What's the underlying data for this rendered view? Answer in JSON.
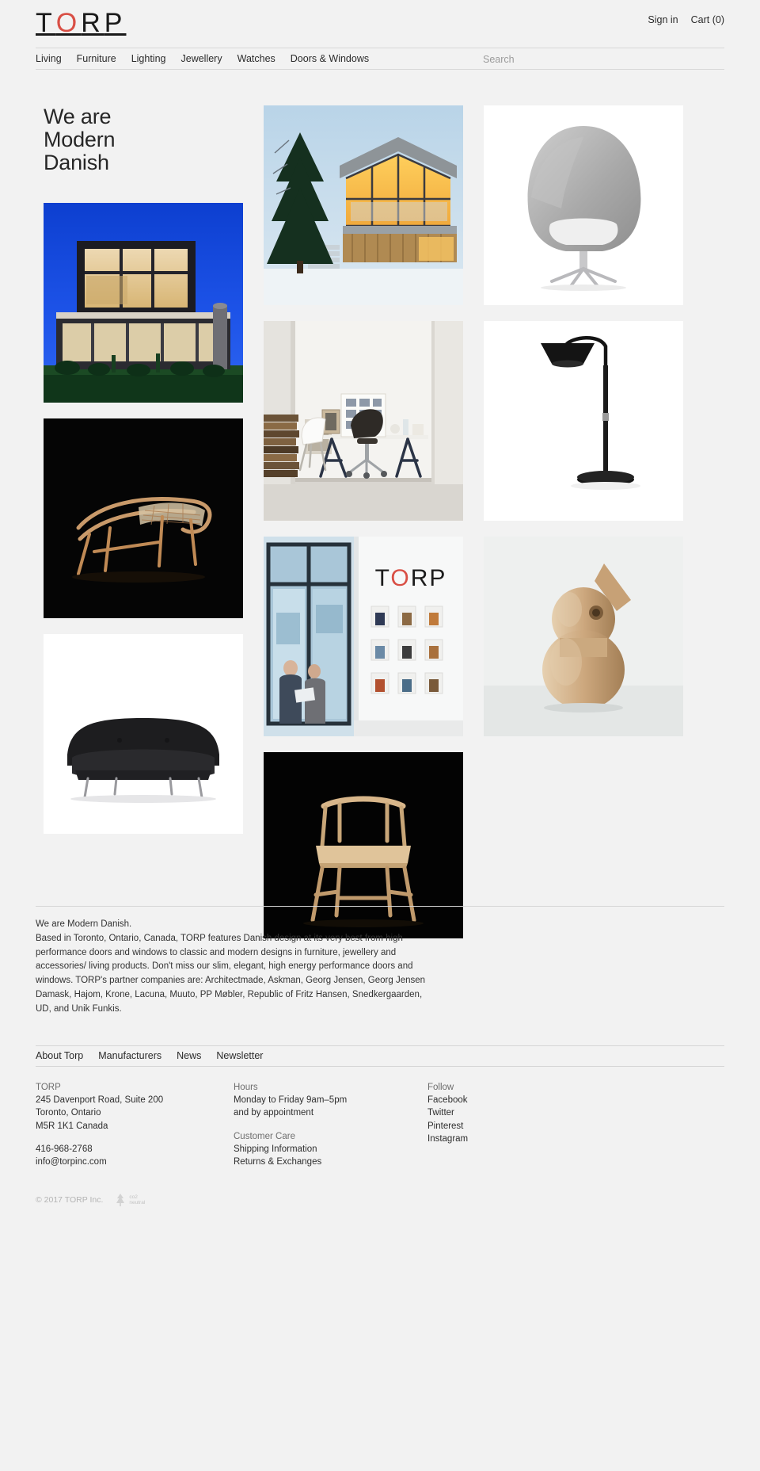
{
  "brand": {
    "logo_letters": [
      "T",
      "O",
      "R",
      "P"
    ],
    "accent_color": "#d94f45",
    "page_bg": "#f2f2f2"
  },
  "header": {
    "sign_in": "Sign in",
    "cart": "Cart (0)",
    "nav": [
      "Living",
      "Furniture",
      "Lighting",
      "Jewellery",
      "Watches",
      "Doors & Windows"
    ],
    "search_placeholder": "Search"
  },
  "hero": {
    "title_line1": "We are",
    "title_line2": "Modern",
    "title_line3": "Danish"
  },
  "gallery": {
    "left": [
      {
        "name": "modern-glass-house-dusk",
        "caption": "Modern glass house at dusk"
      },
      {
        "name": "bronze-lounge-chair-black-bg",
        "caption": "Bronze lounge chair on black"
      },
      {
        "name": "black-leather-sofa-white-bg",
        "caption": "Black leather sofa on white"
      }
    ],
    "middle": [
      {
        "name": "timber-gabled-cabin-snow",
        "caption": "Timber gabled cabin in snow"
      },
      {
        "name": "bright-home-office-interior",
        "caption": "Bright home office interior"
      },
      {
        "name": "torp-showroom-storefront",
        "caption": "TORP showroom storefront",
        "sign_text": "TORP"
      },
      {
        "name": "wooden-armchair-black-bg",
        "caption": "Wooden armchair on black"
      }
    ],
    "right": [
      {
        "name": "grey-egg-lounge-chair",
        "caption": "Grey egg lounge chair"
      },
      {
        "name": "black-kaiser-floor-lamp",
        "caption": "Black floor lamp"
      },
      {
        "name": "wooden-bird-figurine",
        "caption": "Wooden bird figurine"
      }
    ]
  },
  "about": {
    "lead": "We are Modern Danish.",
    "body": "Based in Toronto, Ontario, Canada, TORP features Danish design at its very best from high performance doors and windows to classic and modern designs in furniture, jewellery and accessories/ living products. Don't miss our slim, elegant, high energy performance doors and windows. TORP's partner companies are: Architectmade, Askman, Georg Jensen, Georg Jensen Damask, Hajom, Krone, Lacuna, Muuto, PP Møbler, Republic of Fritz Hansen, Snedkergaarden, UD, and Unik Funkis."
  },
  "footer": {
    "nav": [
      "About Torp",
      "Manufacturers",
      "News",
      "Newsletter"
    ],
    "company": {
      "name": "TORP",
      "address_line1": "245 Davenport Road, Suite 200",
      "address_line2": "Toronto, Ontario",
      "address_line3": "M5R 1K1 Canada",
      "phone": "416-968-2768",
      "email": "info@torpinc.com"
    },
    "hours": {
      "heading": "Hours",
      "line1": "Monday to Friday 9am–5pm",
      "line2": "and by appointment"
    },
    "customer_care": {
      "heading": "Customer Care",
      "links": [
        "Shipping Information",
        "Returns & Exchanges"
      ]
    },
    "follow": {
      "heading": "Follow",
      "links": [
        "Facebook",
        "Twitter",
        "Pinterest",
        "Instagram"
      ]
    },
    "copyright": "© 2017 TORP Inc.",
    "co2_line1": "co2",
    "co2_line2": "neutral"
  }
}
